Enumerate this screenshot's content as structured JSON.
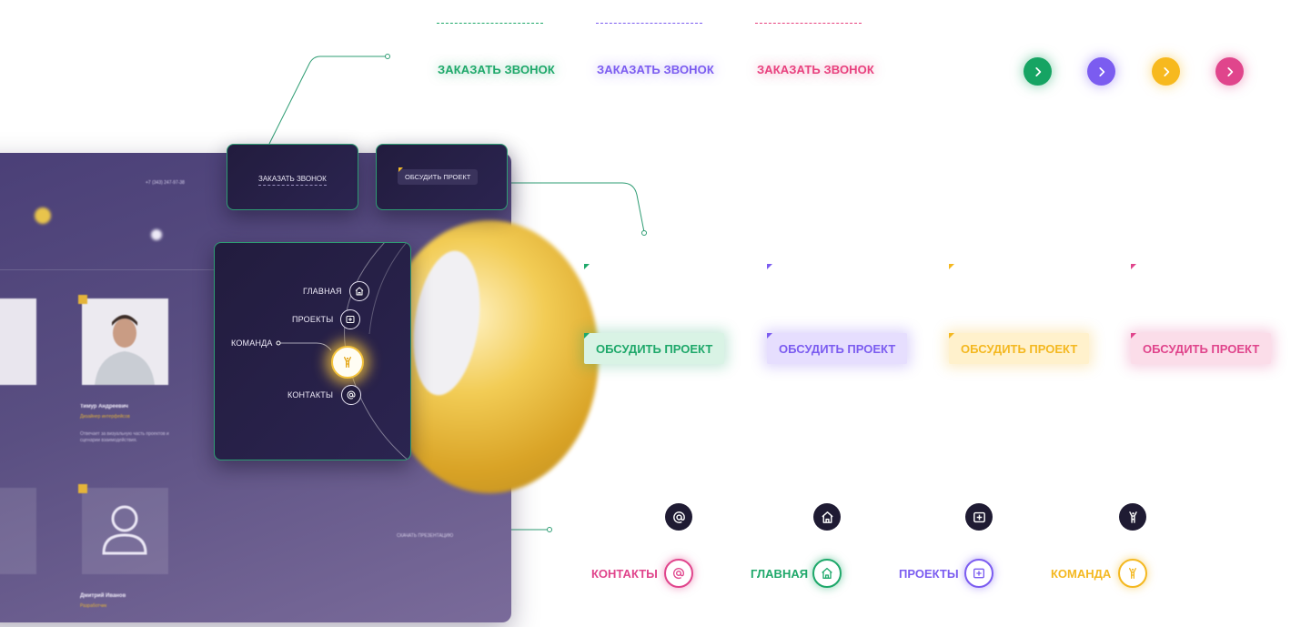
{
  "mockup": {
    "phone": "+7 (343) 247-97-38",
    "member1_name": "Тимур Андреевич",
    "member1_role": "Дизайнер интерфейсов",
    "member1_text": "Отвечает за визуальную часть проектов и сценарии взаимодействия.",
    "member2_name": "Дмитрий Иванов",
    "member2_role": "Разработчик",
    "left_text": "…",
    "cta": "СКАЧАТЬ ПРЕЗЕНТАЦИЮ"
  },
  "preview": {
    "call_label": "ЗАКАЗАТЬ ЗВОНОК",
    "discuss_label": "ОБСУДИТЬ ПРОЕКТ"
  },
  "nav": {
    "items": [
      {
        "label": "ГЛАВНАЯ",
        "icon": "home-icon"
      },
      {
        "label": "ПРОЕКТЫ",
        "icon": "plus-square-icon"
      },
      {
        "label": "КОМАНДА",
        "icon": "team-icon"
      },
      {
        "label": "КОНТАКТЫ",
        "icon": "at-icon"
      }
    ],
    "active": "КОМАНДА"
  },
  "call_buttons": [
    {
      "label": "ЗАКАЗАТЬ ЗВОНОК",
      "color": "#1ea86a"
    },
    {
      "label": "ЗАКАЗАТЬ ЗВОНОК",
      "color": "#7b5cf0"
    },
    {
      "label": "ЗАКАЗАТЬ ЗВОНОК",
      "color": "#e8417e"
    }
  ],
  "arrow_buttons": [
    {
      "icon": "chevron-right-icon",
      "color": "#16a463"
    },
    {
      "icon": "chevron-right-icon",
      "color": "#7b5cf0"
    },
    {
      "icon": "chevron-right-icon",
      "color": "#f7b91e"
    },
    {
      "icon": "chevron-right-icon",
      "color": "#e0458c"
    }
  ],
  "discuss_buttons": [
    {
      "label": "ОБСУДИТЬ ПРОЕКТ",
      "color": "#1ea86a",
      "bg": "#d6f4e4"
    },
    {
      "label": "ОБСУДИТЬ ПРОЕКТ",
      "color": "#7b5cf0",
      "bg": "#e6deff"
    },
    {
      "label": "ОБСУДИТЬ ПРОЕКТ",
      "color": "#f4b820",
      "bg": "#fff0c9"
    },
    {
      "label": "ОБСУДИТЬ ПРОЕКТ",
      "color": "#e0458c",
      "bg": "#fbdbe8"
    }
  ],
  "icon_states": [
    {
      "label": "КОНТАКТЫ",
      "icon": "at-icon",
      "color": "#e0458c"
    },
    {
      "label": "ГЛАВНАЯ",
      "icon": "home-icon",
      "color": "#1ea86a"
    },
    {
      "label": "ПРОЕКТЫ",
      "icon": "plus-square-icon",
      "color": "#7b5cf0"
    },
    {
      "label": "КОМАНДА",
      "icon": "team-icon",
      "color": "#f4b820"
    }
  ],
  "colors": {
    "connector": "#2e9c73",
    "panel_bg": "#221c3e",
    "dark_icon_bg": "#1f1b33"
  }
}
